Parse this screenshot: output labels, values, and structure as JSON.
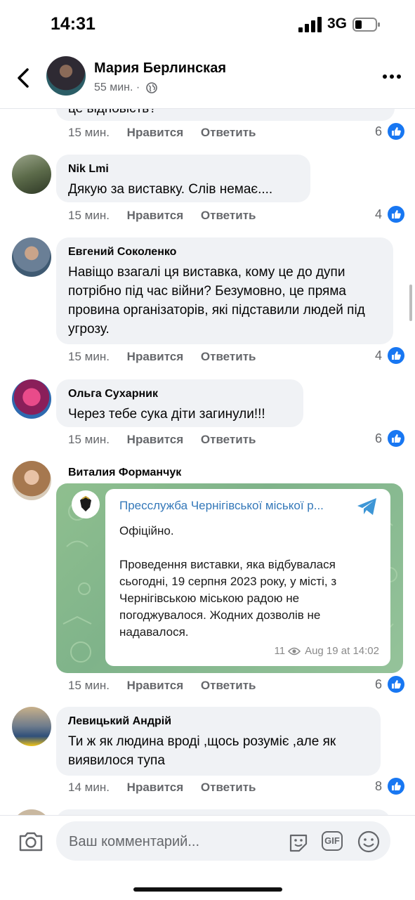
{
  "status_bar": {
    "time": "14:31",
    "network": "3G"
  },
  "header": {
    "name": "Мария Берлинская",
    "time": "55 мин."
  },
  "actions": {
    "like": "Нравится",
    "reply": "Ответить"
  },
  "top_partial": {
    "text": "це відповість?",
    "time": "15 мин.",
    "reactions": "6"
  },
  "comments": [
    {
      "author": "Nik Lmi",
      "text": "Дякую за виставку. Слів немає....",
      "time": "15 мин.",
      "reactions": "4"
    },
    {
      "author": "Евгений Соколенко",
      "text": "Навіщо взагалі ця виставка, кому це до дупи потрібно під час війни? Безумовно, це пряма провина організаторів, які підставили людей під угрозу.",
      "time": "15 мин.",
      "reactions": "4"
    },
    {
      "author": "Ольга Сухарник",
      "text": "Через тебе сука діти загинули!!!",
      "time": "15 мин.",
      "reactions": "6"
    },
    {
      "author": "Виталия Форманчук",
      "text": "",
      "time": "15 мин.",
      "reactions": "6"
    },
    {
      "author": "Левицький Андрій",
      "text": "Ти ж як людина вроді ,щось розуміє ,але як виявилося тупа",
      "time": "14 мин.",
      "reactions": "8"
    }
  ],
  "telegram_post": {
    "channel": "Пресслужба Чернігівської міської р...",
    "line1": "Офіційно.",
    "body": "Проведення виставки, яка відбувалася сьогодні, 19 серпня 2023 року, у місті, з Чернігівською міською радою не погоджувалося. Жодних дозволів не надавалося.",
    "views": "11",
    "date": "Aug 19 at 14:02"
  },
  "composer": {
    "placeholder": "Ваш комментарий...",
    "gif_label": "GIF"
  },
  "colors": {
    "like_blue": "#1877f2",
    "link_blue": "#3478b9",
    "bubble_grey": "#f0f2f5",
    "meta_grey": "#65676b"
  }
}
